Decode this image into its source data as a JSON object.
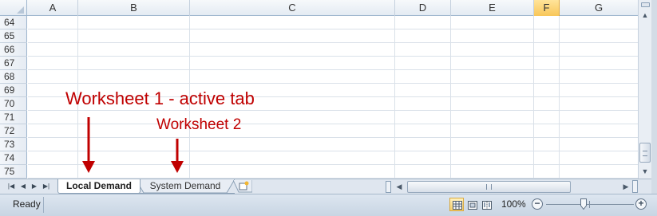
{
  "columns": [
    "A",
    "B",
    "C",
    "D",
    "E",
    "F",
    "G"
  ],
  "active_column": "F",
  "rows": [
    "64",
    "65",
    "66",
    "67",
    "68",
    "69",
    "70",
    "71",
    "72",
    "73",
    "74",
    "75"
  ],
  "annotations": {
    "active_tab_note": "Worksheet 1 - active tab",
    "second_sheet_note": "Worksheet 2",
    "color": "#c00000"
  },
  "sheet_tabs": [
    {
      "label": "Local Demand",
      "active": true
    },
    {
      "label": "System Demand",
      "active": false
    }
  ],
  "tab_navigation": [
    "first-sheet-icon",
    "previous-sheet-icon",
    "next-sheet-icon",
    "last-sheet-icon"
  ],
  "status": {
    "text": "Ready",
    "zoom": "100%",
    "zoom_percent": 100,
    "views": [
      "normal-view-icon",
      "page-layout-view-icon",
      "page-break-preview-icon"
    ],
    "active_view": "normal-view-icon"
  },
  "accent_color": "#f8c659"
}
